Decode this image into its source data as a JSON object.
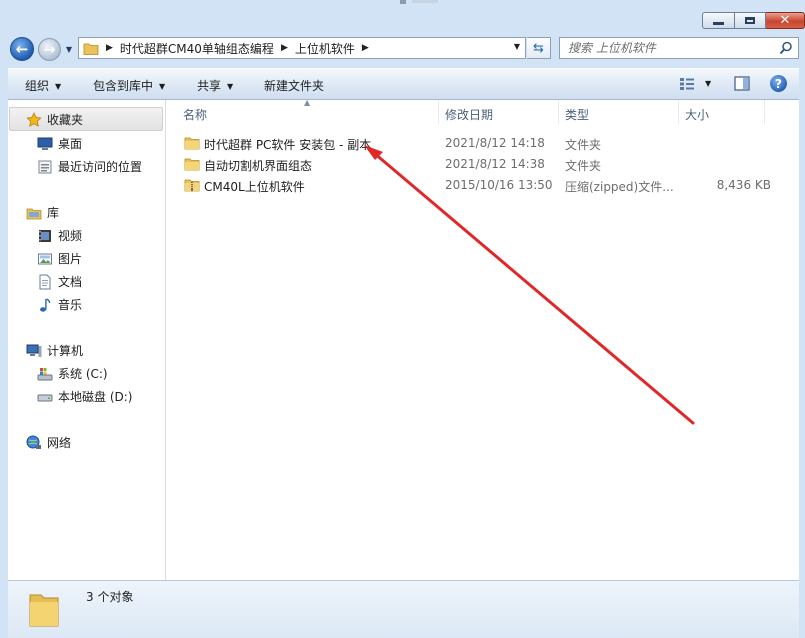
{
  "window": {
    "close_glyph": "✕"
  },
  "address": {
    "crumbs": [
      "时代超群CM40单轴组态编程",
      "上位机软件"
    ]
  },
  "search": {
    "placeholder": "搜索 上位机软件"
  },
  "toolbar": {
    "organize": "组织",
    "include_library": "包含到库中",
    "share": "共享",
    "new_folder": "新建文件夹",
    "help": "?"
  },
  "sidebar": {
    "favorites": "收藏夹",
    "desktop": "桌面",
    "recent": "最近访问的位置",
    "libraries": "库",
    "videos": "视频",
    "pictures": "图片",
    "documents": "文档",
    "music": "音乐",
    "computer": "计算机",
    "drive_c": "系统 (C:)",
    "drive_d": "本地磁盘 (D:)",
    "network": "网络"
  },
  "columns": {
    "name": "名称",
    "date": "修改日期",
    "type": "类型",
    "size": "大小"
  },
  "files": [
    {
      "name": "时代超群 PC软件 安装包 - 副本",
      "date": "2021/8/12 14:18",
      "type": "文件夹",
      "size": "",
      "icon": "folder-icon"
    },
    {
      "name": "自动切割机界面组态",
      "date": "2021/8/12 14:38",
      "type": "文件夹",
      "size": "",
      "icon": "folder-icon"
    },
    {
      "name": "CM40L上位机软件",
      "date": "2015/10/16 13:50",
      "type": "压缩(zipped)文件...",
      "size": "8,436 KB",
      "icon": "zip-folder-icon"
    }
  ],
  "status": {
    "count": "3 个对象"
  },
  "annotation": {
    "color": "#e02828"
  }
}
